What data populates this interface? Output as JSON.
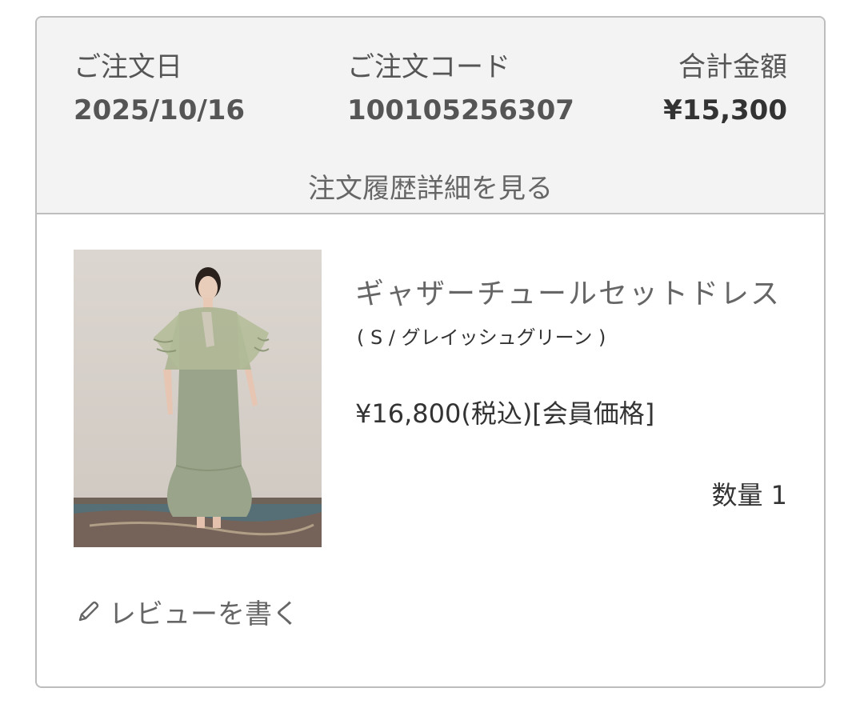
{
  "order": {
    "date_label": "ご注文日",
    "date_value": "2025/10/16",
    "code_label": "ご注文コード",
    "code_value": "100105256307",
    "total_label": "合計金額",
    "total_value": "¥15,300",
    "detail_link": "注文履歴詳細を見る"
  },
  "product": {
    "name": "ギャザーチュールセットドレス",
    "variant": "( S / グレイッシュグリーン )",
    "price": "¥16,800(税込)[会員価格]",
    "quantity_label": "数量 1",
    "image_icon": "dress-photo"
  },
  "review": {
    "icon": "pencil-icon",
    "label": "レビューを書く"
  },
  "colors": {
    "border": "#bdbdbd",
    "header_bg": "#f3f3f3",
    "text_gray": "#555555",
    "dress_green": "#9aa48a"
  }
}
